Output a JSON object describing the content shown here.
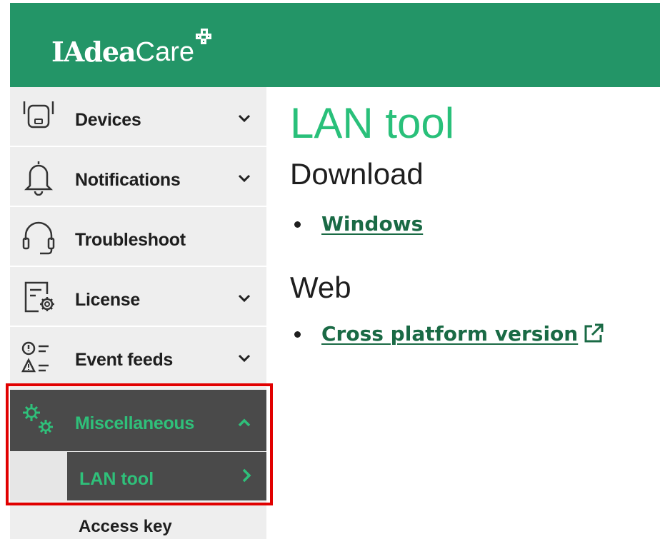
{
  "header": {
    "logo_iadea": "IAdea",
    "logo_care": "Care",
    "background": "#239567"
  },
  "sidebar": {
    "items": [
      {
        "label": "Devices",
        "icon": "device-icon",
        "chevron": "down"
      },
      {
        "label": "Notifications",
        "icon": "bell-icon",
        "chevron": "down"
      },
      {
        "label": "Troubleshoot",
        "icon": "headset-icon",
        "chevron": null
      },
      {
        "label": "License",
        "icon": "license-icon",
        "chevron": "down"
      },
      {
        "label": "Event feeds",
        "icon": "event-feeds-icon",
        "chevron": "down"
      },
      {
        "label": "Miscellaneous",
        "icon": "gears-icon",
        "chevron": "up",
        "active": true
      }
    ],
    "subitems": [
      {
        "label": "LAN tool",
        "active": true
      },
      {
        "label": "Access key",
        "active": false
      }
    ]
  },
  "main": {
    "title": "LAN tool",
    "sections": [
      {
        "heading": "Download",
        "links": [
          {
            "label": "Windows",
            "external": false
          }
        ]
      },
      {
        "heading": "Web",
        "links": [
          {
            "label": "Cross platform version",
            "external": true
          }
        ]
      }
    ]
  },
  "colors": {
    "brand_green": "#239567",
    "accent_green": "#29c07a",
    "link_green": "#1a6a45",
    "active_bg": "#4a4a4a",
    "highlight": "#e10000"
  }
}
